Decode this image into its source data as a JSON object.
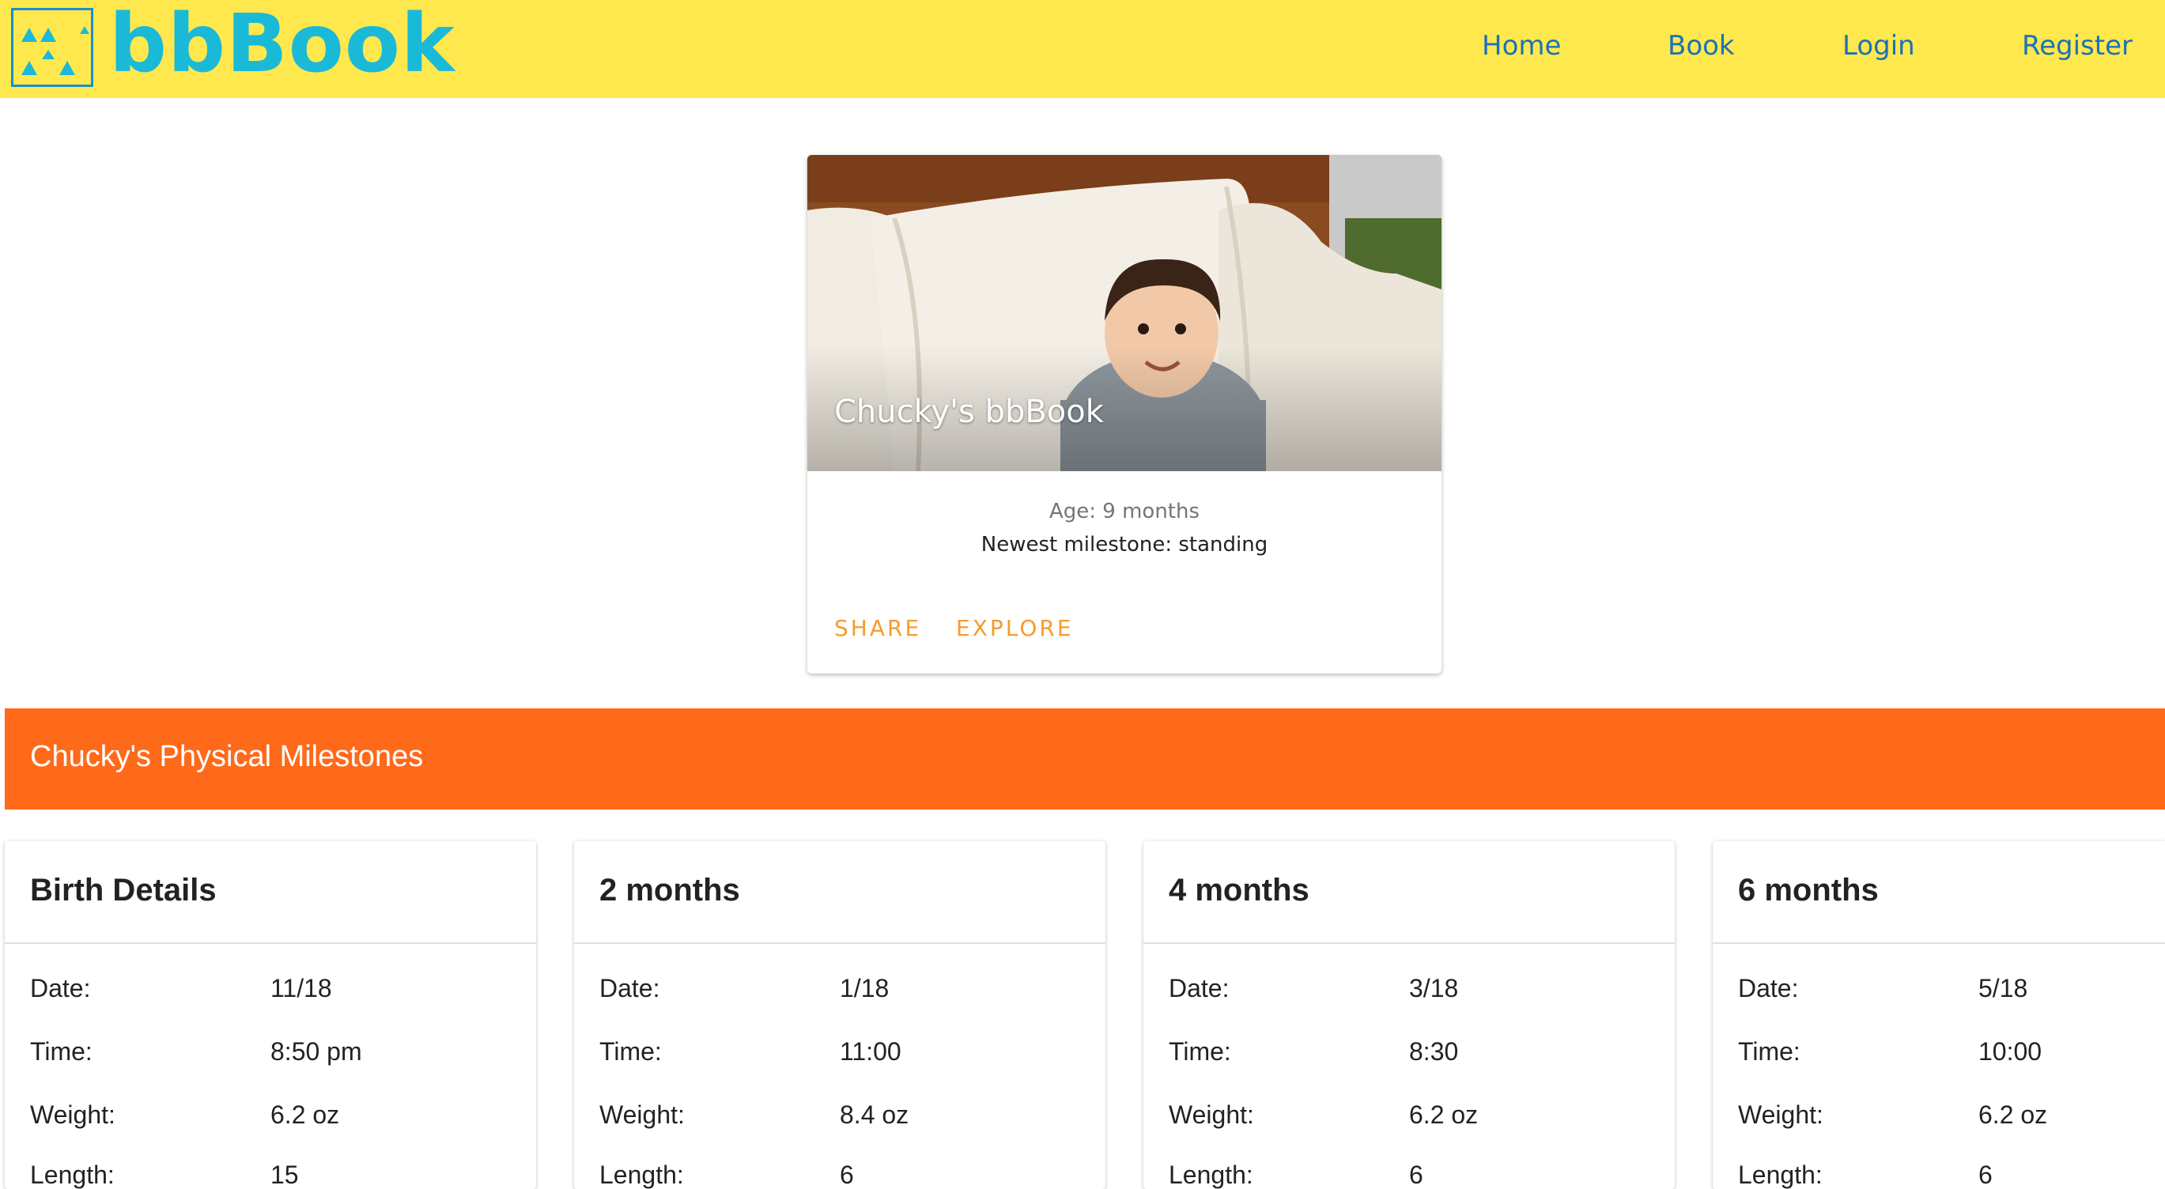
{
  "brand": {
    "name": "bbBook",
    "logo_icon": "triangles-logo-icon"
  },
  "nav": [
    {
      "label": "Home"
    },
    {
      "label": "Book"
    },
    {
      "label": "Login"
    },
    {
      "label": "Register"
    }
  ],
  "profile_card": {
    "title": "Chucky's bbBook",
    "age": "Age: 9 months",
    "milestone": "Newest milestone: standing",
    "actions": [
      "SHARE",
      "EXPLORE"
    ],
    "photo": "baby-on-couch-photo"
  },
  "section": {
    "title": "Chucky's Physical Milestones"
  },
  "milestones": [
    {
      "title": "Birth Details",
      "rows": [
        {
          "label": "Date:",
          "value": "11/18"
        },
        {
          "label": "Time:",
          "value": "8:50 pm"
        },
        {
          "label": "Weight:",
          "value": "6.2 oz"
        },
        {
          "label": "Length:",
          "value": "15"
        }
      ]
    },
    {
      "title": "2 months",
      "rows": [
        {
          "label": "Date:",
          "value": "1/18"
        },
        {
          "label": "Time:",
          "value": "11:00"
        },
        {
          "label": "Weight:",
          "value": "8.4 oz"
        },
        {
          "label": "Length:",
          "value": "6"
        }
      ]
    },
    {
      "title": "4 months",
      "rows": [
        {
          "label": "Date:",
          "value": "3/18"
        },
        {
          "label": "Time:",
          "value": "8:30"
        },
        {
          "label": "Weight:",
          "value": "6.2 oz"
        },
        {
          "label": "Length:",
          "value": "6"
        }
      ]
    },
    {
      "title": "6 months",
      "rows": [
        {
          "label": "Date:",
          "value": "5/18"
        },
        {
          "label": "Time:",
          "value": "10:00"
        },
        {
          "label": "Weight:",
          "value": "6.2 oz"
        },
        {
          "label": "Length:",
          "value": "6"
        }
      ]
    }
  ],
  "colors": {
    "header_bg": "#ffe84d",
    "brand_text": "#1ab9d8",
    "nav_link": "#1a72b8",
    "accent_orange": "#ff6a1a",
    "action_text": "#f79a2e"
  }
}
